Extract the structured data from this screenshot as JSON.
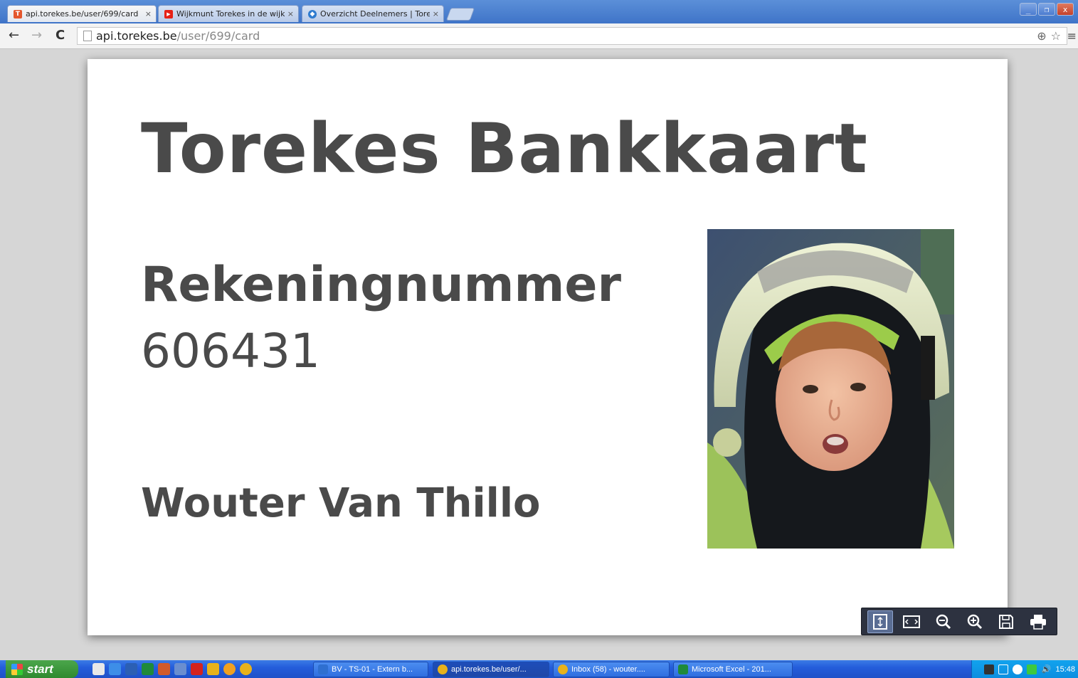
{
  "browser": {
    "tabs": [
      {
        "title": "api.torekes.be/user/699/card",
        "favicon_letter": "T",
        "favicon_color": "#e4572e"
      },
      {
        "title": "Wijkmunt Torekes in de wijk",
        "favicon_letter": "▶",
        "favicon_color": "#e62117"
      },
      {
        "title": "Overzicht Deelnemers | Tore",
        "favicon_letter": "◆",
        "favicon_color": "#2e7bcf"
      }
    ],
    "close_glyph": "×",
    "url_host": "api.torekes.be",
    "url_path": "/user/699/card"
  },
  "card": {
    "title": "Torekes Bankkaart",
    "account_label": "Rekeningnummer",
    "account_number": "606431",
    "holder_name": "Wouter Van Thillo"
  },
  "pdf_controls": [
    "fit-page",
    "fit-width",
    "zoom-out",
    "zoom-in",
    "save",
    "print"
  ],
  "taskbar": {
    "start_label": "start",
    "tasks": [
      {
        "label": "BV - TS-01 - Extern b...",
        "icon_color": "#2f6fd0"
      },
      {
        "label": "api.torekes.be/user/...",
        "icon_color": "#e8b21b"
      },
      {
        "label": "Inbox (58) - wouter....",
        "icon_color": "#e8b21b"
      },
      {
        "label": "Microsoft Excel - 201...",
        "icon_color": "#1f8a3a"
      }
    ],
    "clock": "15:48"
  },
  "colors": {
    "card_text": "#4a4a4a",
    "viewer_bg": "#d6d6d6",
    "pdf_controls_bg": "#2d3240"
  }
}
